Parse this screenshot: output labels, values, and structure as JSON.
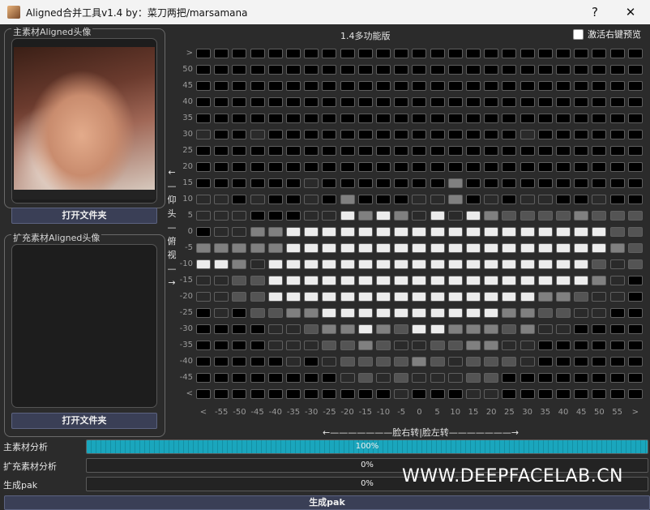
{
  "window": {
    "title": "Aligned合并工具v1.4  by：菜刀两把/marsamana",
    "help_glyph": "?",
    "close_glyph": "✕"
  },
  "main_panel": {
    "label": "主素材Aligned头像",
    "open_button": "打开文件夹"
  },
  "extra_panel": {
    "label": "扩充素材Aligned头像",
    "open_button": "打开文件夹"
  },
  "grid": {
    "title": "1.4多功能版",
    "preview_checkbox": {
      "label": "激活右键预览",
      "checked": false
    },
    "row_labels": [
      ">",
      "50",
      "45",
      "40",
      "35",
      "30",
      "25",
      "20",
      "15",
      "10",
      "5",
      "0",
      "-5",
      "-10",
      "-15",
      "-20",
      "-25",
      "-30",
      "-35",
      "-40",
      "-45",
      "<"
    ],
    "col_labels": [
      "<",
      "-55",
      "-50",
      "-45",
      "-40",
      "-35",
      "-30",
      "-25",
      "-20",
      "-15",
      "-10",
      "-5",
      "0",
      "5",
      "10",
      "15",
      "20",
      "25",
      "30",
      "35",
      "40",
      "45",
      "50",
      "55",
      ">"
    ],
    "vertical_axis_label": "←—仰头—俯视—→",
    "horizontal_axis_label": "←———————脸右转|脸左转———————→",
    "cell_colors": {
      "0": "#000000",
      "1": "#2a2a2a",
      "2": "#545454",
      "3": "#808080",
      "4": "#ececec"
    },
    "levels": [
      "0000000000000000000000000",
      "0000000000000000000000000",
      "0000000000000000000000000",
      "0000000000000000000000000",
      "0000000000000000000000000",
      "1001000000000000001000000",
      "0000000000000000000000000",
      "0000000000000000000000000",
      "0000001000000030000000000",
      "1101001030001130101100100",
      "1110001143431414322223222",
      "0113344444444444444444422",
      "3333344444444444444444432",
      "4431444444444444444444212",
      "1122444444444444444444310",
      "1122444444444444444332110",
      "0102233444444444433221100",
      "0000112334324433323110000",
      "0000111223211223311000000",
      "0000010122223212221000000",
      "0000000012121112200000000",
      "0000000000010001100000000"
    ]
  },
  "progress": [
    {
      "label": "主素材分析",
      "value": 100,
      "text": "100%"
    },
    {
      "label": "扩充素材分析",
      "value": 0,
      "text": "0%"
    },
    {
      "label": "生成pak",
      "value": 0,
      "text": "0%"
    }
  ],
  "generate_button": "生成pak",
  "watermark": "WWW.DEEPFACELAB.CN"
}
